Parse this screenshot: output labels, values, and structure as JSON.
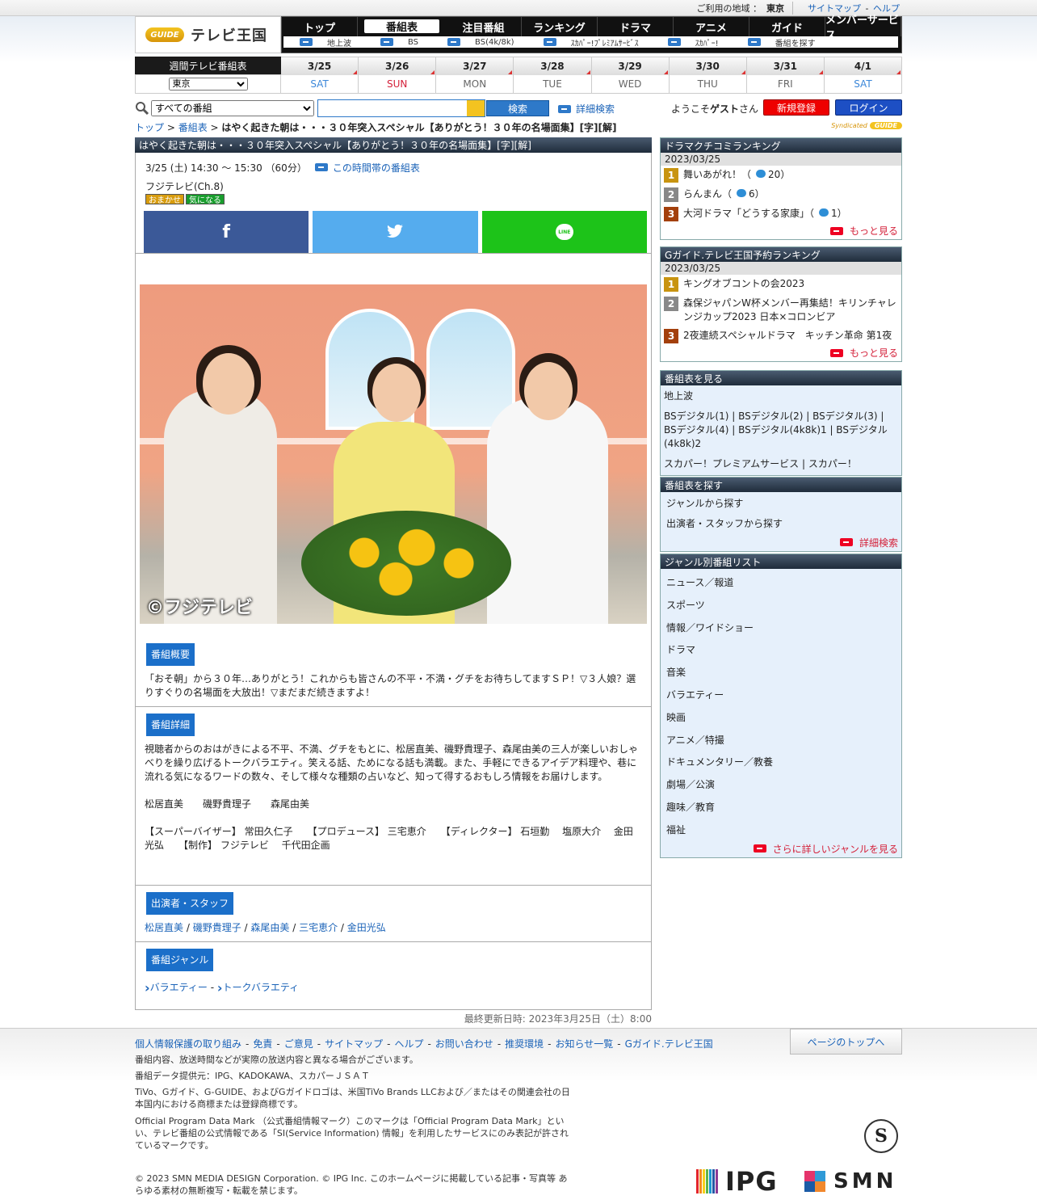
{
  "topbar": {
    "region_label": "ご利用の地域 ：",
    "region_value": "東京",
    "sitemap": "サイトマップ",
    "sep": "-",
    "help": "ヘルプ"
  },
  "logo": {
    "badge": "GUIDE",
    "title": "テレビ王国"
  },
  "nav": {
    "tabs": [
      "トップ",
      "番組表",
      "注目番組",
      "ランキング",
      "ドラマ",
      "アニメ",
      "ガイド",
      "メンバーサービス"
    ],
    "sub": [
      "地上波",
      "BS",
      "BS(4k/8k)",
      "ｽｶﾊﾟｰ!ﾌﾟﾚﾐｱﾑｻｰﾋﾞｽ",
      "ｽｶﾊﾟｰ!",
      "番組を探す"
    ]
  },
  "week": {
    "label": "週間テレビ番組表",
    "region_select": "東京",
    "days": [
      {
        "date": "3/25",
        "wd": "SAT",
        "cls": "sat"
      },
      {
        "date": "3/26",
        "wd": "SUN",
        "cls": "sun"
      },
      {
        "date": "3/27",
        "wd": "MON",
        "cls": ""
      },
      {
        "date": "3/28",
        "wd": "TUE",
        "cls": ""
      },
      {
        "date": "3/29",
        "wd": "WED",
        "cls": ""
      },
      {
        "date": "3/30",
        "wd": "THU",
        "cls": ""
      },
      {
        "date": "3/31",
        "wd": "FRI",
        "cls": ""
      },
      {
        "date": "4/1",
        "wd": "SAT",
        "cls": "sat"
      }
    ]
  },
  "search": {
    "scope": "すべての番組",
    "button": "検索",
    "advanced": "詳細検索",
    "welcome_pre": "ようこそ",
    "welcome_name": "ゲスト",
    "welcome_post": "さん",
    "register": "新規登録",
    "login": "ログイン"
  },
  "breadcrumb": {
    "top": "トップ",
    "sep1": " > ",
    "schedule": "番組表",
    "sep2": " > ",
    "current": "はやく起きた朝は・・・３０年突入スペシャル【ありがとう！３０年の名場面集】[字][解]"
  },
  "syndicated": {
    "label": "Syndicated",
    "badge": "GUIDE"
  },
  "program": {
    "title": "はやく起きた朝は・・・３０年突入スペシャル【ありがとう！３０年の名場面集】[字][解]",
    "time": "3/25 (土) 14:30 ～ 15:30 （60分）",
    "time_link": "この時間帯の番組表",
    "channel": "フジテレビ(Ch.8)",
    "tags": [
      "おまかせ",
      "気になる"
    ],
    "share": {
      "facebook": "f",
      "twitter": "🐦",
      "line": "LINE"
    },
    "photo_credit": "©フジテレビ",
    "summary_title": "番組概要",
    "summary": "「おそ朝」から３０年…ありがとう！これからも皆さんの不平・不満・グチをお待ちしてますＳＰ！▽３人娘？選りすぐりの名場面を大放出！▽まだまだ続きますよ！",
    "detail_title": "番組詳細",
    "detail_p1": "視聴者からのおはがきによる不平、不満、グチをもとに、松居直美、磯野貴理子、森尾由美の三人が楽しいおしゃべりを繰り広げるトークバラエティ。笑える話、ためになる話も満載。また、手軽にできるアイデア料理や、巷に流れる気になるワードの数々、そして様々な種類の占いなど、知って得するおもしろ情報をお届けします。",
    "detail_p2": "松居直美　　磯野貴理子　　森尾由美",
    "detail_p3": "【スーパーバイザー】 常田久仁子　　【プロデュース】 三宅恵介　　【ディレクター】 石垣勤　 塩原大介　 金田光弘　　【制作】 フジテレビ　 千代田企画",
    "cast_title": "出演者・スタッフ",
    "cast": [
      "松居直美",
      "磯野貴理子",
      "森尾由美",
      "三宅恵介",
      "金田光弘"
    ],
    "cast_sep": " / ",
    "genre_title": "番組ジャンル",
    "genres": [
      "バラエティー",
      "トークバラエティ"
    ],
    "genre_sep": " - ",
    "updated": "最終更新日時: 2023年3月25日（土）8:00"
  },
  "side": {
    "drama": {
      "title": "ドラマクチコミランキング",
      "date": "2023/03/25",
      "items": [
        {
          "rank": "1",
          "name": "舞いあがれ！",
          "count": "20"
        },
        {
          "rank": "2",
          "name": "らんまん",
          "count": "6"
        },
        {
          "rank": "3",
          "name": "大河ドラマ「どうする家康」",
          "count": "1"
        }
      ],
      "more": "もっと見る"
    },
    "reserve": {
      "title": "Gガイド.テレビ王国予約ランキング",
      "date": "2023/03/25",
      "items": [
        {
          "rank": "1",
          "name": "キングオブコントの会2023"
        },
        {
          "rank": "2",
          "name": "森保ジャパンW杯メンバー再集結！キリンチャレンジカップ2023 日本×コロンビア"
        },
        {
          "rank": "3",
          "name": "2夜連続スペシャルドラマ　キッチン革命 第1夜"
        }
      ],
      "more": "もっと見る"
    },
    "view": {
      "title": "番組表を見る",
      "l1": "地上波",
      "l2": "BSデジタル(1) | BSデジタル(2) | BSデジタル(3) | BSデジタル(4) | BSデジタル(4k8k)1 | BSデジタル(4k8k)2",
      "l3": "スカパー！プレミアムサービス | スカパー！"
    },
    "find": {
      "title": "番組表を探す",
      "items": [
        "ジャンルから探す",
        "出演者・スタッフから探す"
      ],
      "more": "詳細検索"
    },
    "genre": {
      "title": "ジャンル別番組リスト",
      "items": [
        "ニュース／報道",
        "スポーツ",
        "情報／ワイドショー",
        "ドラマ",
        "音楽",
        "バラエティー",
        "映画",
        "アニメ／特撮",
        "ドキュメンタリー／教養",
        "劇場／公演",
        "趣味／教育",
        "福祉"
      ],
      "more": "さらに詳しいジャンルを見る"
    }
  },
  "footer": {
    "links": [
      "個人情報保護の取り組み",
      "免責",
      "ご意見",
      "サイトマップ",
      "ヘルプ",
      "お問い合わせ",
      "推奨環境",
      "お知らせ一覧",
      "Gガイド.テレビ王国"
    ],
    "pagetop": "ページのトップへ",
    "p1": "番組内容、放送時間などが実際の放送内容と異なる場合がございます。",
    "p2": "番組データ提供元：IPG、KADOKAWA、スカパーＪＳＡＴ",
    "p3": "TiVo、Gガイド、G-GUIDE、およびGガイドロゴは、米国TiVo Brands LLCおよび／またはその関連会社の日本国内における商標または登録商標です。",
    "p4": "Official Program Data Mark （公式番組情報マーク）このマークは「Official Program Data Mark」といい、テレビ番組の公式情報である「SI(Service Information) 情報」を利用したサービスにのみ表記が許されているマークです。",
    "p5": "© 2023 SMN MEDIA DESIGN Corporation. © IPG Inc. このホームページに掲載している記事・写真等 あらゆる素材の無断複写・転載を禁じます。",
    "seal": "S",
    "ipg": "IPG",
    "smn": "SMN"
  }
}
